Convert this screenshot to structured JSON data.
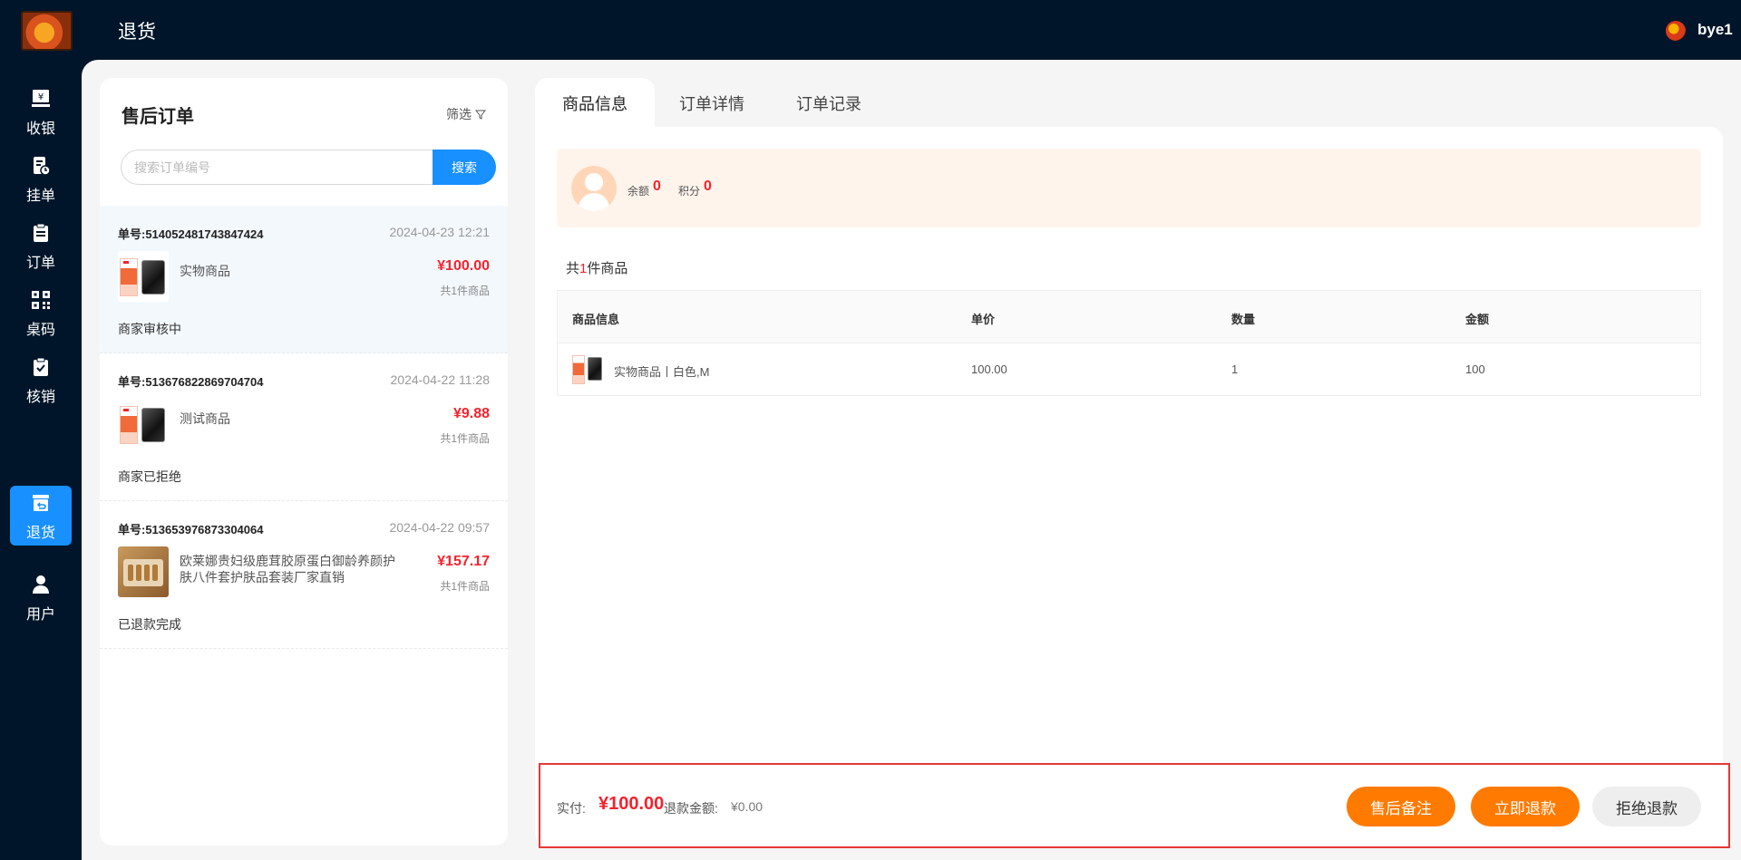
{
  "header": {
    "title": "退货",
    "user_name": "bye1"
  },
  "sidebar": {
    "items": [
      {
        "label": "收银",
        "icon": "cashier-icon"
      },
      {
        "label": "挂单",
        "icon": "hang-order-icon"
      },
      {
        "label": "订单",
        "icon": "order-icon"
      },
      {
        "label": "桌码",
        "icon": "qr-code-icon"
      },
      {
        "label": "核销",
        "icon": "verify-icon"
      },
      {
        "label": "退货",
        "icon": "return-icon",
        "active": true
      },
      {
        "label": "用户",
        "icon": "user-icon"
      }
    ]
  },
  "orders_panel": {
    "title": "售后订单",
    "filter_label": "筛选",
    "search_placeholder": "搜索订单编号",
    "search_button": "搜索",
    "orders": [
      {
        "order_no": "单号:514052481743847424",
        "time": "2024-04-23 12:21",
        "product": "实物商品",
        "price": "¥100.00",
        "count": "共1件商品",
        "status": "商家审核中",
        "selected": true
      },
      {
        "order_no": "单号:513676822869704704",
        "time": "2024-04-22 11:28",
        "product": "测试商品",
        "price": "¥9.88",
        "count": "共1件商品",
        "status": "商家已拒绝"
      },
      {
        "order_no": "单号:513653976873304064",
        "time": "2024-04-22 09:57",
        "product": "欧莱娜贵妇级鹿茸胶原蛋白御龄养颜护肤八件套护肤品套装厂家直销",
        "price": "¥157.17",
        "count": "共1件商品",
        "status": "已退款完成"
      }
    ]
  },
  "detail": {
    "tabs": [
      "商品信息",
      "订单详情",
      "订单记录"
    ],
    "active_tab": 0,
    "member": {
      "balance_label": "余额",
      "balance": "0",
      "points_label": "积分",
      "points": "0"
    },
    "count_line": {
      "prefix": "共",
      "num": "1",
      "suffix": "件商品"
    },
    "table": {
      "headers": [
        "商品信息",
        "单价",
        "数量",
        "金额"
      ],
      "rows": [
        {
          "product": "实物商品丨白色,M",
          "unit_price": "100.00",
          "qty": "1",
          "amount": "100"
        }
      ]
    }
  },
  "footer": {
    "paid_label": "实付:",
    "paid_value": "¥100.00",
    "refund_label": "退款金额:",
    "refund_value": "¥0.00",
    "buttons": {
      "note": "售后备注",
      "refund": "立即退款",
      "reject": "拒绝退款"
    }
  },
  "colors": {
    "nav_bg": "#001529",
    "accent": "#1890ff",
    "price": "#f5222d",
    "orange": "#ff7a00",
    "highlight_border": "#e53935"
  }
}
